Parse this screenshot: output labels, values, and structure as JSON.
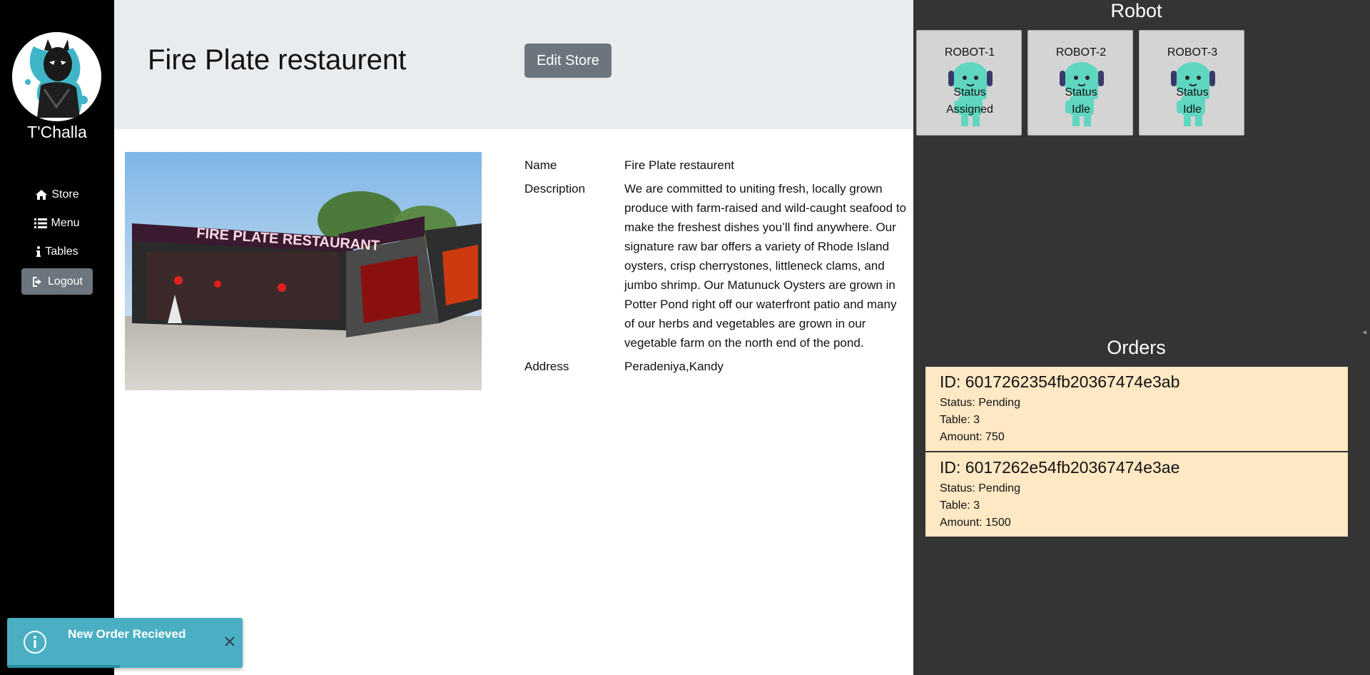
{
  "sidebar": {
    "username": "T'Challa",
    "nav": {
      "store": "Store",
      "menu": "Menu",
      "tables": "Tables",
      "logout": "Logout"
    }
  },
  "header": {
    "title": "Fire Plate restaurent",
    "edit_button": "Edit Store"
  },
  "store_image": {
    "sign_text": "FIRE PLATE RESTAURANT"
  },
  "details": {
    "name_label": "Name",
    "name_value": "Fire Plate restaurent",
    "description_label": "Description",
    "description_value": "We are committed to uniting fresh, locally grown produce with farm-raised and wild-caught seafood to make the freshest dishes you’ll find anywhere. Our signature raw bar offers a variety of Rhode Island oysters, crisp cherrystones, littleneck clams, and jumbo shrimp. Our Matunuck Oysters are grown in Potter Pond right off our waterfront patio and many of our herbs and vegetables are grown in our vegetable farm on the north end of the pond.",
    "address_label": "Address",
    "address_value": "Peradeniya,Kandy"
  },
  "robot_panel": {
    "title": "Robot",
    "robots": [
      {
        "name": "ROBOT-1",
        "status_label": "Status",
        "status": "Assigned"
      },
      {
        "name": "ROBOT-2",
        "status_label": "Status",
        "status": "Idle"
      },
      {
        "name": "ROBOT-3",
        "status_label": "Status",
        "status": "Idle"
      }
    ]
  },
  "orders_panel": {
    "title": "Orders",
    "orders": [
      {
        "id": "ID: 6017262354fb20367474e3ab",
        "status": "Status: Pending",
        "table": "Table: 3",
        "amount": "Amount: 750"
      },
      {
        "id": "ID: 6017262e54fb20367474e3ae",
        "status": "Status: Pending",
        "table": "Table: 3",
        "amount": "Amount: 1500"
      }
    ]
  },
  "toast": {
    "message": "New Order Recieved",
    "icon": "info-icon",
    "progress": 0.48
  },
  "colors": {
    "sidebar_bg": "#000000",
    "header_bg": "#e9ecef",
    "button_gray": "#6c757d",
    "panel_bg": "#343434",
    "order_bg": "#ffe8c4",
    "toast_bg": "#4bafc4",
    "robot_teal": "#5fd6c0"
  }
}
